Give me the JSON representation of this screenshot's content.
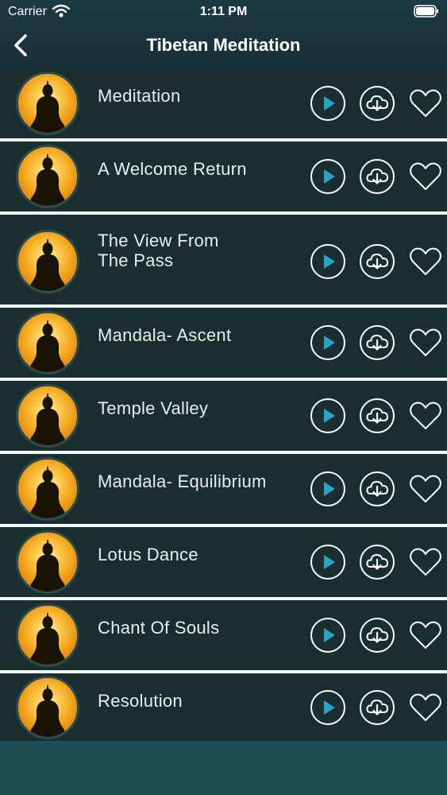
{
  "status_bar": {
    "carrier": "Carrier",
    "time": "1:11 PM"
  },
  "nav": {
    "title": "Tibetan Meditation",
    "back_icon": "chevron-left-icon"
  },
  "colors": {
    "header_bg": "#183039",
    "row_bg": "#1a2e30",
    "separator": "#f2f6f6",
    "accent": "#2aa3c8",
    "footer_bg": "#1f4d55"
  },
  "tracks": [
    {
      "title": "Meditation"
    },
    {
      "title": "A Welcome Return"
    },
    {
      "title": "The View From\nThe Pass"
    },
    {
      "title": "Mandala- Ascent"
    },
    {
      "title": "Temple Valley"
    },
    {
      "title": "Mandala- Equilibrium"
    },
    {
      "title": "Lotus Dance"
    },
    {
      "title": "Chant Of Souls"
    },
    {
      "title": "Resolution"
    }
  ]
}
